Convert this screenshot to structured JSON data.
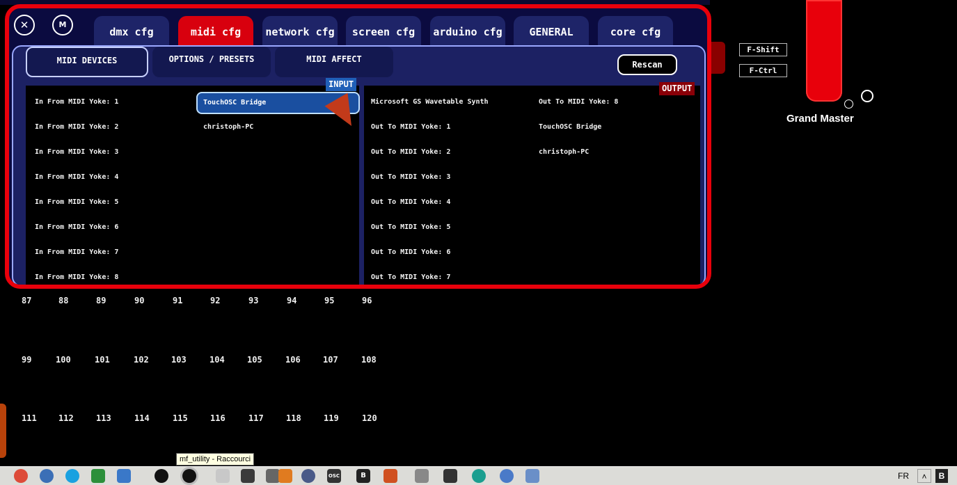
{
  "dialog": {
    "close_glyph": "✕",
    "m_label": "M",
    "tabs": [
      "dmx cfg",
      "midi cfg",
      "network cfg",
      "screen cfg",
      "arduino cfg",
      "GENERAL",
      "core cfg"
    ],
    "active_tab": "midi cfg",
    "subtabs": [
      "MIDI DEVICES",
      "OPTIONS / PRESETS",
      "MIDI AFFECT"
    ],
    "active_subtab": "MIDI DEVICES",
    "rescan_label": "Rescan",
    "input_badge": "INPUT",
    "output_badge": "OUTPUT",
    "inputs_col1": [
      "In From MIDI Yoke:  1",
      "In From MIDI Yoke:  2",
      "In From MIDI Yoke:  3",
      "In From MIDI Yoke:  4",
      "In From MIDI Yoke:  5",
      "In From MIDI Yoke:  6",
      "In From MIDI Yoke:  7",
      "In From MIDI Yoke:  8"
    ],
    "inputs_col2": [
      "TouchOSC Bridge",
      "christoph-PC"
    ],
    "selected_input": "TouchOSC Bridge",
    "outputs_col1": [
      "Microsoft GS Wavetable Synth",
      "Out To MIDI Yoke:  1",
      "Out To MIDI Yoke:  2",
      "Out To MIDI Yoke:  3",
      "Out To MIDI Yoke:  4",
      "Out To MIDI Yoke:  5",
      "Out To MIDI Yoke:  6",
      "Out To MIDI Yoke:  7"
    ],
    "outputs_col2": [
      "Out To MIDI Yoke:  8",
      "TouchOSC Bridge",
      "christoph-PC"
    ]
  },
  "modifiers": {
    "shift": "F-Shift",
    "ctrl": "F-Ctrl"
  },
  "grand_master": {
    "label": "Grand Master"
  },
  "channels": {
    "row1": [
      "87",
      "88",
      "89",
      "90",
      "91",
      "92",
      "93",
      "94",
      "95",
      "96"
    ],
    "row2": [
      "99",
      "100",
      "101",
      "102",
      "103",
      "104",
      "105",
      "106",
      "107",
      "108"
    ],
    "row3": [
      "111",
      "112",
      "113",
      "114",
      "115",
      "116",
      "117",
      "118",
      "119",
      "120"
    ]
  },
  "taskbar": {
    "tooltip": "mf_utility - Raccourci",
    "language": "FR",
    "tray_chevron": "˄",
    "tray_b": "B",
    "icons": [
      "chrome",
      "network",
      "skype",
      "windows",
      "explorer",
      "cat",
      "cat-selected",
      "music",
      "ninja",
      "terminal",
      "brush",
      "clock",
      "osc",
      "b-app",
      "media",
      "square",
      "chat",
      "arduino",
      "globe",
      "network-2"
    ]
  },
  "colors": {
    "accent_red": "#e8000b",
    "panel_blue": "#1c2163",
    "input_blue": "#2060b8",
    "output_red": "#8a0008"
  }
}
